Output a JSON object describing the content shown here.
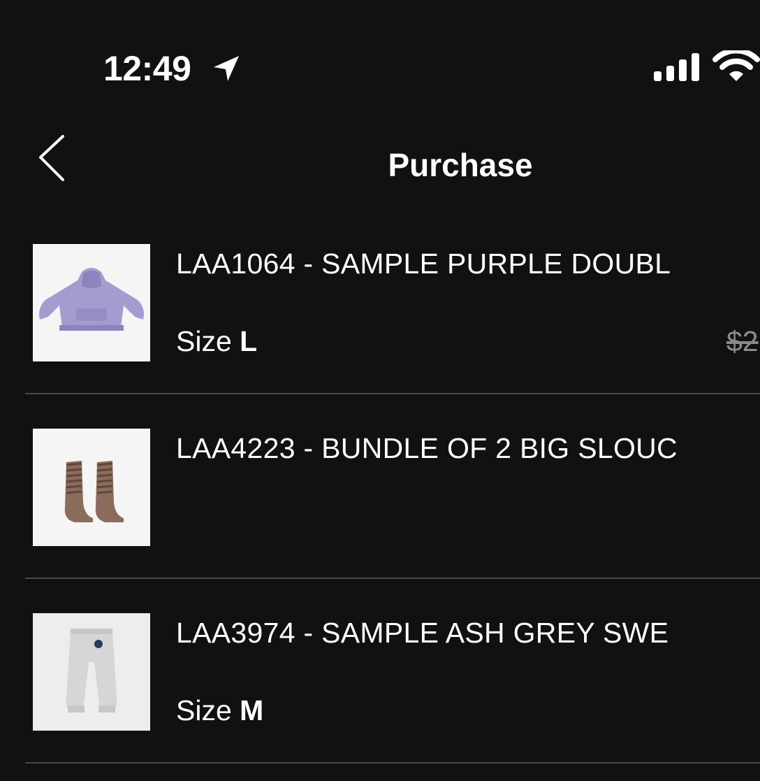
{
  "status_bar": {
    "time": "12:49",
    "icons": [
      "location-arrow-icon",
      "cellular-signal-icon",
      "wifi-icon"
    ]
  },
  "nav": {
    "back_icon": "chevron-left-icon",
    "title": "Purchase"
  },
  "items": [
    {
      "name": "LAA1064 - SAMPLE PURPLE DOUBL",
      "size_label": "Size",
      "size_value": "L",
      "price": "$2",
      "image": "purple-hoodie"
    },
    {
      "name": "LAA4223 - BUNDLE OF 2 BIG SLOUC",
      "image": "brown-slouch-socks"
    },
    {
      "name": "LAA3974 - SAMPLE ASH GREY SWE",
      "size_label": "Size",
      "size_value": "M",
      "image": "ash-grey-sweatpants"
    }
  ],
  "colors": {
    "background": "#111111",
    "text": "#ffffff",
    "divider": "#4a4a4a",
    "strikethrough_price": "#8a8a8a"
  }
}
